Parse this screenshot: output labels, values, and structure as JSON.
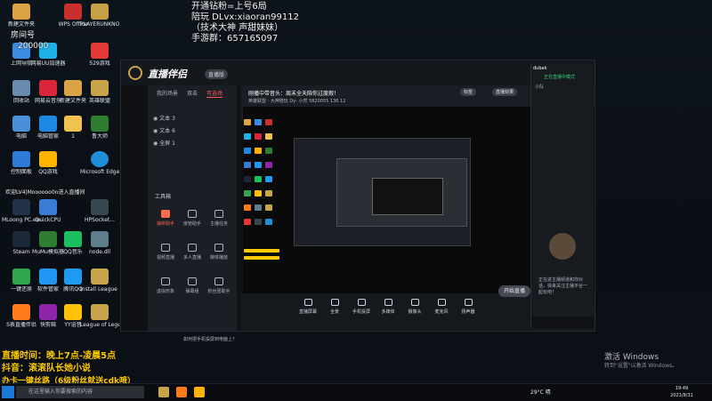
{
  "overlay": {
    "top_right_lines": [
      "开通钻粉=上号6局",
      "陪玩 DLvx:xiaoran99112",
      "（技术大神 声甜妹妹）",
      "手游群：657165097"
    ],
    "room_label": "房间号",
    "room_number": "200000",
    "join_text": "欢迎LV4|Moooooo0n进入直播间",
    "bottom_left_lines": [
      "直播时间：晚上7点-凌晨5点",
      "抖音：滚滚队长她小说",
      "办卡一键丝路（6级粉丝就送cdk哦）"
    ]
  },
  "desktop_icons": [
    {
      "label": "新建文件夹",
      "color": "#d9a441"
    },
    {
      "label": "上网导航",
      "color": "#3b8be0"
    },
    {
      "label": "回收站",
      "color": "#6a8bb0"
    },
    {
      "label": "电脑",
      "color": "#4a90d9"
    },
    {
      "label": "控制面板",
      "color": "#2f7bd8"
    },
    {
      "label": "MLoong PC.exe",
      "color": "#22324a"
    },
    {
      "label": "Steam",
      "color": "#1b2838"
    },
    {
      "label": "一键还原",
      "color": "#2fa84f"
    },
    {
      "label": "S表直播伴侣",
      "color": "#ff7a1a"
    },
    {
      "label": "WPS Office",
      "color": "#c9302c"
    },
    {
      "label": "网易UU加速器",
      "color": "#1db1e6"
    },
    {
      "label": "网易云音乐",
      "color": "#d8263a"
    },
    {
      "label": "电脑管家",
      "color": "#1e88e5"
    },
    {
      "label": "QQ游戏",
      "color": "#ffb300"
    },
    {
      "label": "QuickCPU",
      "color": "#3a7bd5"
    },
    {
      "label": "MuMu模拟器",
      "color": "#2e7d32"
    },
    {
      "label": "软件管家",
      "color": "#2196f3"
    },
    {
      "label": "快剪辑",
      "color": "#8e24aa"
    },
    {
      "label": "PLAYERUNKNOWN'S BATTLEGR...",
      "color": "#c7a048"
    },
    {
      "label": "新建文件夹",
      "color": "#d9a441"
    },
    {
      "label": "1",
      "color": "#f0c34e"
    },
    {
      "label": "QQ音乐",
      "color": "#1bbf5f"
    },
    {
      "label": "腾讯QQ",
      "color": "#1e9bf0"
    },
    {
      "label": "YY语音",
      "color": "#ffc107"
    },
    {
      "label": "529游戏",
      "color": "#e53935"
    },
    {
      "label": "英雄联盟",
      "color": "#c9a44a"
    },
    {
      "label": "鲁大师",
      "color": "#2e7d32"
    },
    {
      "label": "Microsoft Edge",
      "color": "#1d8fd6"
    },
    {
      "label": "HPSocket...",
      "color": "#37474f"
    },
    {
      "label": "node.dll",
      "color": "#607d8b"
    },
    {
      "label": "Install League ...",
      "color": "#c9a44a"
    },
    {
      "label": "League of Legends",
      "color": "#c9a44a"
    }
  ],
  "app": {
    "name": "直播伴侣",
    "version": "直播版",
    "tabs": [
      "我的场景",
      "双击",
      "可选场"
    ],
    "scenes": [
      "文本 3",
      "文本 6",
      "全屏 1"
    ],
    "tools_title": "工具箱",
    "tools": [
      {
        "label": "抽奖助手",
        "hl": true
      },
      {
        "label": "房管助手",
        "hl": false
      },
      {
        "label": "主播任务",
        "hl": false
      },
      {
        "label": "视频直播",
        "hl": false
      },
      {
        "label": "多人直播",
        "hl": false
      },
      {
        "label": "媒体播放",
        "hl": false
      },
      {
        "label": "虚拟形象",
        "hl": false
      },
      {
        "label": "弹幕组",
        "hl": false
      },
      {
        "label": "粉丝团助手",
        "hl": false
      }
    ],
    "stage_title": "刚播中带音头：周末全天陪你过度假！",
    "stage_btn_1": "标签",
    "stage_btn_2": "直播效果",
    "stage_sub": "英雄联盟 · 大神陪玩   Dy- 小然 5820055   136   12",
    "bottom_items": [
      "直播屏幕",
      "全景",
      "手机投屏",
      "多媒体",
      "摄像头",
      "麦克风",
      "扬声器"
    ],
    "live_button": "开始直播",
    "mobile_link": "如何把手机投屏到电脑上？"
  },
  "chat": {
    "title": "dubak",
    "mode": "正在直播中模式",
    "section": "小队",
    "message": "正在进主播频道和你对话，快来关注主播平台一起玩吧！"
  },
  "taskbar": {
    "search_placeholder": "在这里输入你要搜索的内容",
    "weather": "29°C 晴",
    "time": "19:49",
    "date": "2021/8/31"
  },
  "watermark": {
    "line1": "激活 Windows",
    "line2": "转到\"设置\"以激活 Windows。"
  }
}
